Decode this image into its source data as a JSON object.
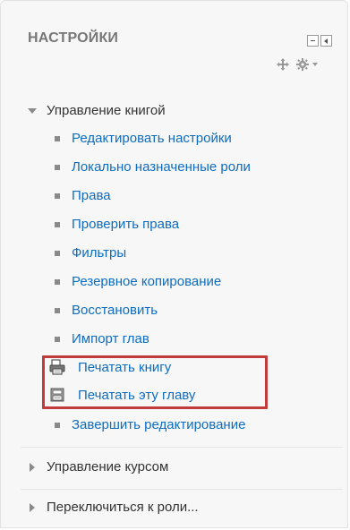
{
  "block": {
    "title": "НАСТРОЙКИ",
    "dock_icon": "dock-icon",
    "hide_icon": "hide-icon",
    "move_icon": "move-icon",
    "gear_icon": "gear-icon"
  },
  "book_admin": {
    "label": "Управление книгой",
    "items": [
      {
        "label": "Редактировать настройки"
      },
      {
        "label": "Локально назначенные роли"
      },
      {
        "label": "Права"
      },
      {
        "label": "Проверить права"
      },
      {
        "label": "Фильтры"
      },
      {
        "label": "Резервное копирование"
      },
      {
        "label": "Восстановить"
      },
      {
        "label": "Импорт глав"
      }
    ],
    "print_items": [
      {
        "label": "Печатать книгу",
        "icon": "print-book-icon"
      },
      {
        "label": "Печатать эту главу",
        "icon": "print-chapter-icon"
      }
    ],
    "finish_editing": "Завершить редактирование"
  },
  "course_admin": {
    "label": "Управление курсом"
  },
  "switch_role": {
    "label": "Переключиться к роли..."
  },
  "colors": {
    "link": "#0f6cbf",
    "text": "#333333",
    "highlight_border": "#c23b3b"
  }
}
